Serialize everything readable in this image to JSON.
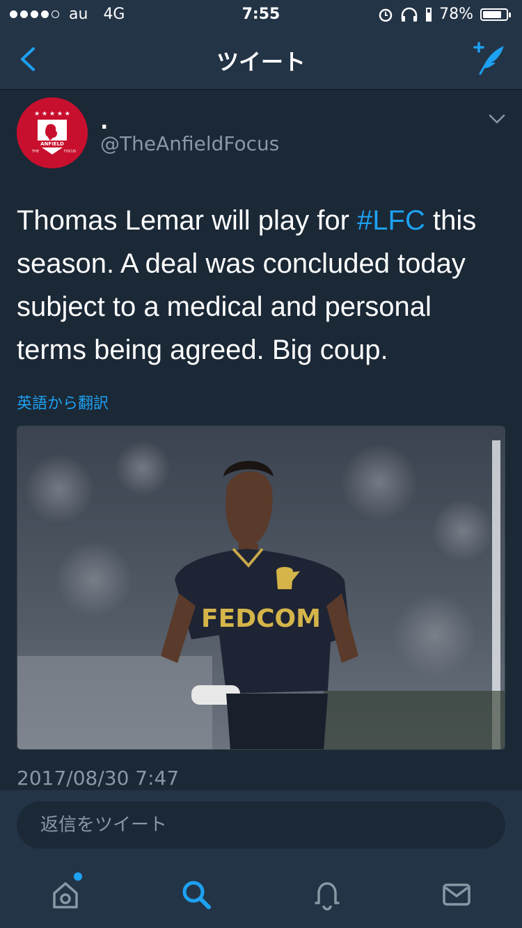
{
  "status_bar": {
    "carrier": "au",
    "network": "4G",
    "time": "7:55",
    "battery": "78%"
  },
  "nav": {
    "title": "ツイート"
  },
  "tweet": {
    "display_name": ".",
    "handle": "@TheAnfieldFocus",
    "text_before": "Thomas Lemar will play for ",
    "hashtag": "#LFC",
    "text_after": " this season. A deal was concluded today subject to a medical and personal terms being agreed. Big coup.",
    "translate": "英語から翻訳",
    "timestamp": "2017/08/30 7:47",
    "avatar_text": {
      "top": "ANFIELD",
      "left": "THE",
      "right": "FOCUS"
    },
    "photo_text": "FEDCOM"
  },
  "reply": {
    "placeholder": "返信をツイート"
  },
  "colors": {
    "accent": "#1da1f2",
    "background": "#1b2836",
    "bar": "#243447",
    "muted": "#8899a6"
  },
  "tabs": [
    {
      "name": "home-icon"
    },
    {
      "name": "search-icon"
    },
    {
      "name": "notifications-icon"
    },
    {
      "name": "messages-icon"
    }
  ]
}
